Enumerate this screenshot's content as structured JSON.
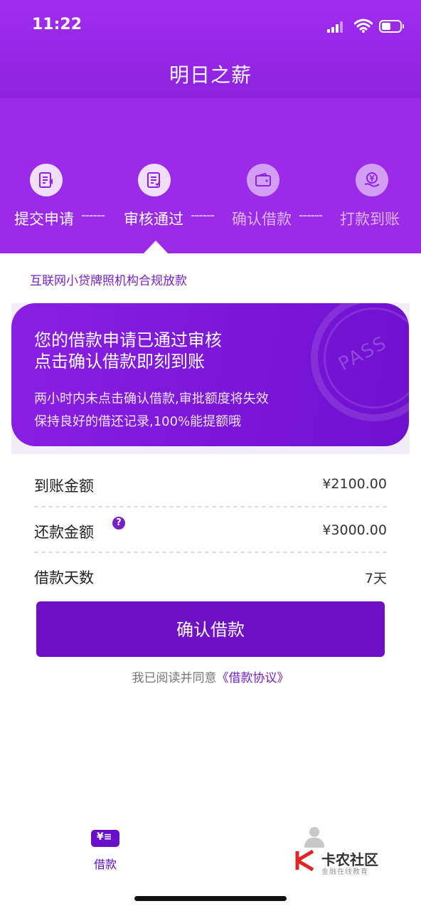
{
  "status_bar": {
    "time": "11:22"
  },
  "app": {
    "title": "明日之薪"
  },
  "steps": [
    {
      "label": "提交申请",
      "icon": "document-edit-icon",
      "active": true
    },
    {
      "label": "审核通过",
      "icon": "checklist-icon",
      "active": true
    },
    {
      "label": "确认借款",
      "icon": "wallet-icon",
      "active": false
    },
    {
      "label": "打款到账",
      "icon": "yen-hand-icon",
      "active": false
    }
  ],
  "separator": "------",
  "compliance_text": "互联网小贷牌照机构合规放款",
  "card": {
    "line1": "您的借款申请已通过审核",
    "line2": "点击确认借款即刻到账",
    "line3": "两小时内未点击确认借款,审批额度将失效",
    "line4": "保持良好的借还记录,100%能提额哦",
    "stamp": "PASS"
  },
  "details": [
    {
      "label": "到账金额",
      "value": "¥2100.00"
    },
    {
      "label": "还款金额",
      "value": "¥3000.00"
    },
    {
      "label": "借款天数",
      "value": "7天"
    }
  ],
  "help_glyph": "?",
  "confirm_button": "确认借款",
  "agreement": {
    "prefix": "我已阅读并同意",
    "link": "《借款协议》"
  },
  "bottom_nav": [
    {
      "label": "借款",
      "icon_text": "¥≡",
      "active": true
    },
    {
      "label": "我的",
      "active": false
    }
  ],
  "watermark": {
    "title": "卡农社区",
    "subtitle": "金融在线教育"
  },
  "colors": {
    "primary": "#7a1fc7",
    "header": "#9b2be8",
    "button": "#6f0fc6"
  }
}
